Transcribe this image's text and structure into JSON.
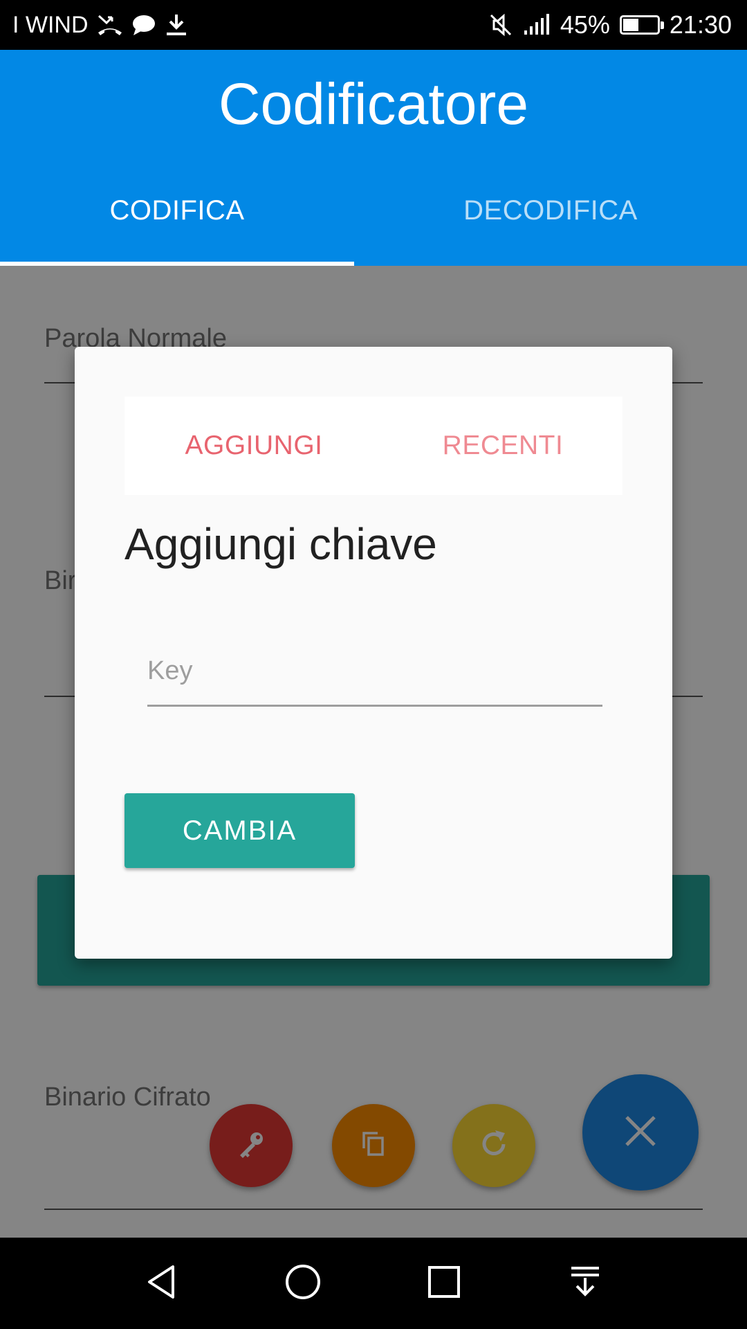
{
  "status_bar": {
    "carrier": "I WIND",
    "icons_left": [
      "missed-call-icon",
      "chat-bubble-icon",
      "download-icon"
    ],
    "icons_right": [
      "mute-icon",
      "signal-icon"
    ],
    "battery_percent": "45%",
    "battery_level": 0.45,
    "time": "21:30"
  },
  "app": {
    "title": "Codificatore",
    "tabs": [
      {
        "label": "CODIFICA",
        "selected": true
      },
      {
        "label": "DECODIFICA",
        "selected": false
      }
    ],
    "accent_color": "#0288e5"
  },
  "background_form": {
    "field1_label": "Parola Normale",
    "field2_label": "Bir",
    "field3_label": "Binario Cifrato"
  },
  "fabs": [
    {
      "name": "key",
      "icon": "key-icon",
      "color": "#e53935"
    },
    {
      "name": "copy",
      "icon": "copy-icon",
      "color": "#fb8c00"
    },
    {
      "name": "refresh",
      "icon": "refresh-icon",
      "color": "#fdd835"
    },
    {
      "name": "close",
      "icon": "close-icon",
      "color": "#1e88e5"
    }
  ],
  "dialog": {
    "tabs": [
      {
        "label": "AGGIUNGI"
      },
      {
        "label": "RECENTI"
      }
    ],
    "heading": "Aggiungi chiave",
    "key_input": {
      "placeholder": "Key",
      "value": ""
    },
    "button_label": "CAMBIA"
  },
  "nav_bar": {
    "icons": [
      "back-icon",
      "home-icon",
      "recents-icon",
      "notification-pull-icon"
    ]
  }
}
